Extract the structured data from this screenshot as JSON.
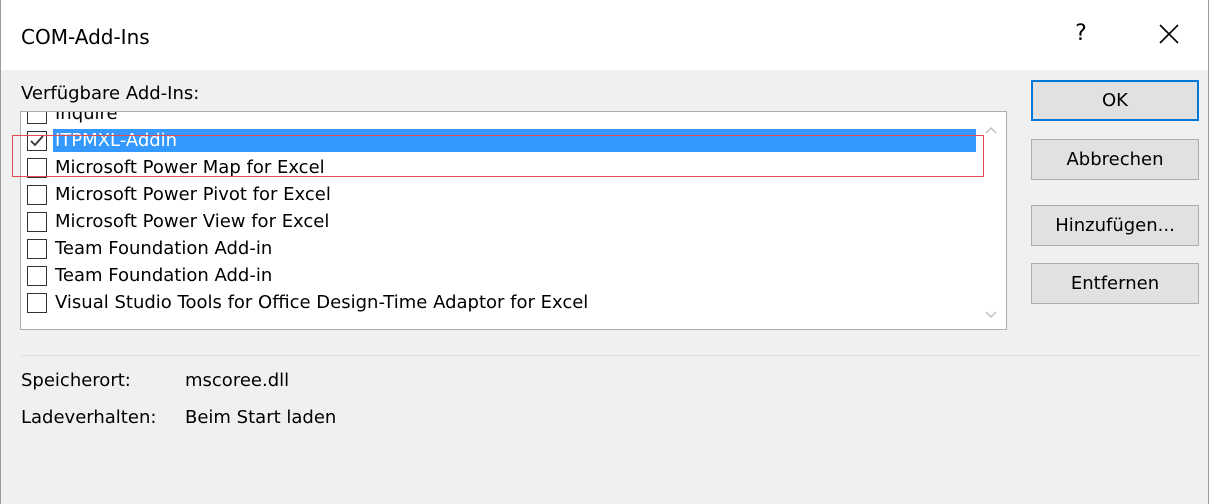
{
  "window": {
    "title": "COM-Add-Ins",
    "help_label": "?"
  },
  "addins": {
    "label": "Verfügbare Add-Ins:",
    "items": [
      {
        "label": "Inquire",
        "checked": false,
        "selected": false
      },
      {
        "label": "ITPMXL-Addin",
        "checked": true,
        "selected": true
      },
      {
        "label": "Microsoft Power Map for Excel",
        "checked": false,
        "selected": false
      },
      {
        "label": "Microsoft Power Pivot for Excel",
        "checked": false,
        "selected": false
      },
      {
        "label": "Microsoft Power View for Excel",
        "checked": false,
        "selected": false
      },
      {
        "label": "Team Foundation Add-in",
        "checked": false,
        "selected": false
      },
      {
        "label": "Team Foundation Add-in",
        "checked": false,
        "selected": false
      },
      {
        "label": "Visual Studio Tools for Office Design-Time Adaptor for Excel",
        "checked": false,
        "selected": false
      }
    ]
  },
  "buttons": {
    "ok": "OK",
    "cancel": "Abbrechen",
    "add": "Hinzufügen...",
    "remove": "Entfernen"
  },
  "details": {
    "location_label": "Speicherort:",
    "location_value": "mscoree.dll",
    "load_label": "Ladeverhalten:",
    "load_value": "Beim Start laden"
  },
  "colors": {
    "selection": "#3399ff",
    "highlight_border": "#e04b55",
    "default_button_border": "#0078d7"
  }
}
